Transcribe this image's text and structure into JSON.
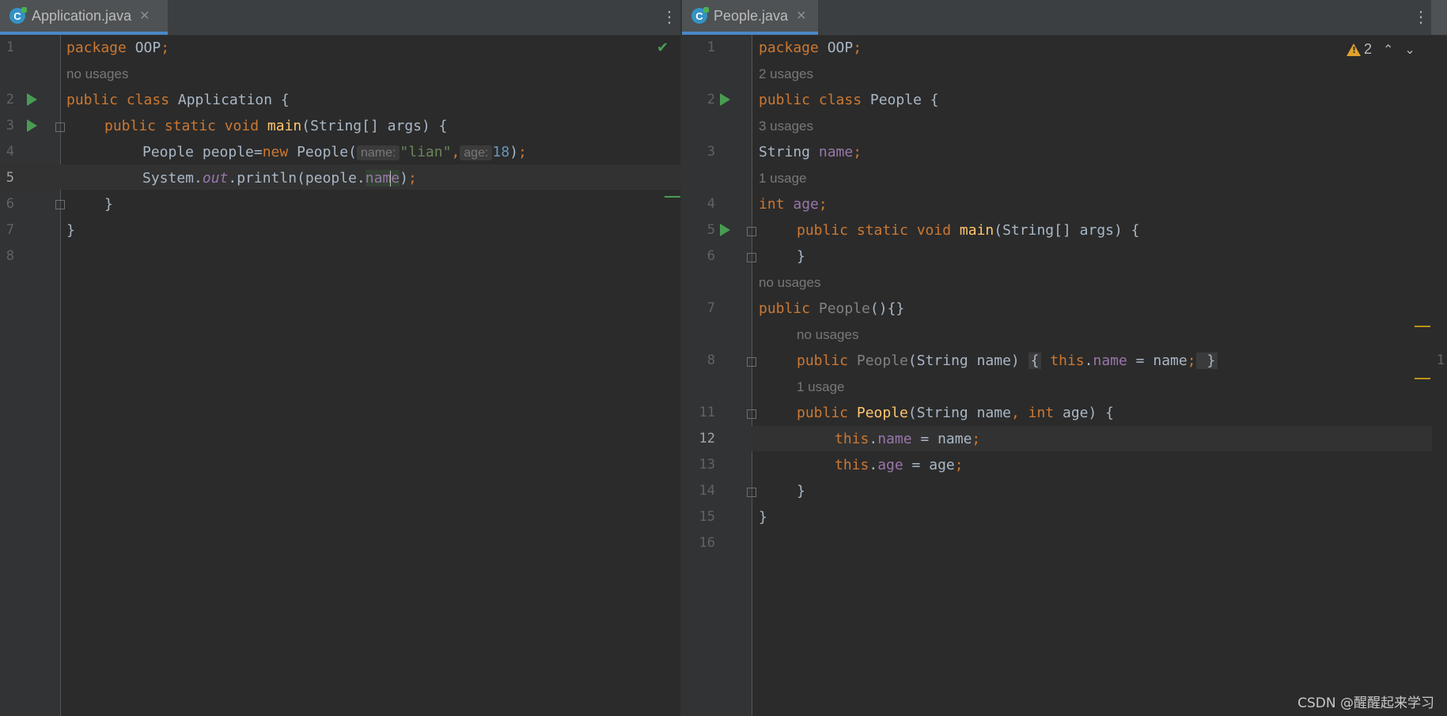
{
  "left_editor": {
    "tab": {
      "label": "Application.java",
      "icon": "C",
      "close": "✕"
    },
    "menu": "⋮",
    "status_icon": "✔",
    "line_numbers": [
      "1",
      "2",
      "3",
      "4",
      "5",
      "6",
      "7",
      "8"
    ],
    "usage_hints": [
      "no usages"
    ],
    "code": {
      "l1": {
        "kw": "package",
        "rest": " OOP",
        "semi": ";"
      },
      "l2": {
        "kw": "public class",
        "rest": " Application {"
      },
      "l3": {
        "kw": "public static void",
        "fn": "main",
        "rest": "(String[] args) {"
      },
      "l4": {
        "a": "People people=",
        "kw": "new",
        "b": " People(",
        "hint_name": "name:",
        "str": "\"lian\"",
        "comma": ",",
        "hint_age": "age:",
        "num": "18",
        "c": ")",
        "semi": ";"
      },
      "l5": {
        "a": "System.",
        "out": "out",
        "b": ".println(people.",
        "sel1": "nam",
        "sel2": "e",
        "c": ")",
        "semi": ";"
      },
      "l6": "}",
      "l7": "}"
    }
  },
  "right_editor": {
    "tab": {
      "label": "People.java",
      "icon": "C",
      "close": "✕"
    },
    "menu": "⋮",
    "warnings": {
      "count": "2",
      "up": "⌃",
      "down": "⌄"
    },
    "line_numbers": [
      "1",
      "2",
      "3",
      "4",
      "5",
      "6",
      "7",
      "8",
      "11",
      "12",
      "13",
      "14",
      "15",
      "16"
    ],
    "usage_hints": [
      "2 usages",
      "3 usages",
      "1 usage",
      "no usages",
      "no usages",
      "1 usage"
    ],
    "edge_number": "1",
    "code": {
      "l1": {
        "kw": "package",
        "rest": " OOP",
        "semi": ";"
      },
      "l2": {
        "kw": "public class",
        "rest": " People {"
      },
      "l3": {
        "a": "String ",
        "fld": "name",
        "semi": ";"
      },
      "l4": {
        "kw": "int",
        "fld": " age",
        "semi": ";"
      },
      "l5": {
        "kw": "public static void",
        "fn": "main",
        "rest": "(String[] args) {"
      },
      "l6": "}",
      "l7": {
        "kw": "public",
        "gray": " People",
        "rest": "(){}"
      },
      "l8": {
        "kw": "public",
        "gray": " People",
        "a": "(String name) ",
        "ob": "{",
        "kw2": " this",
        "dot": ".",
        "fld": "name",
        "b": " = name",
        "semi": ";",
        "cb": " }"
      },
      "l11": {
        "kw": "public",
        "fn": " People",
        "a": "(String name",
        "comma": ",",
        "kw2": " int",
        "b": " age) {"
      },
      "l12": {
        "kw": "this",
        "dot": ".",
        "fld": "name",
        "b": " = name",
        "semi": ";"
      },
      "l13": {
        "kw": "this",
        "dot": ".",
        "fld": "age",
        "b": " = age",
        "semi": ";"
      },
      "l14": "}",
      "l15": "}"
    }
  },
  "watermark": "CSDN @醒醒起来学习",
  "colors": {
    "keyword": "#cc7832",
    "function": "#ffc66d",
    "string": "#6a8759",
    "number": "#6897bb",
    "field": "#9876aa",
    "background": "#2b2b2b"
  }
}
